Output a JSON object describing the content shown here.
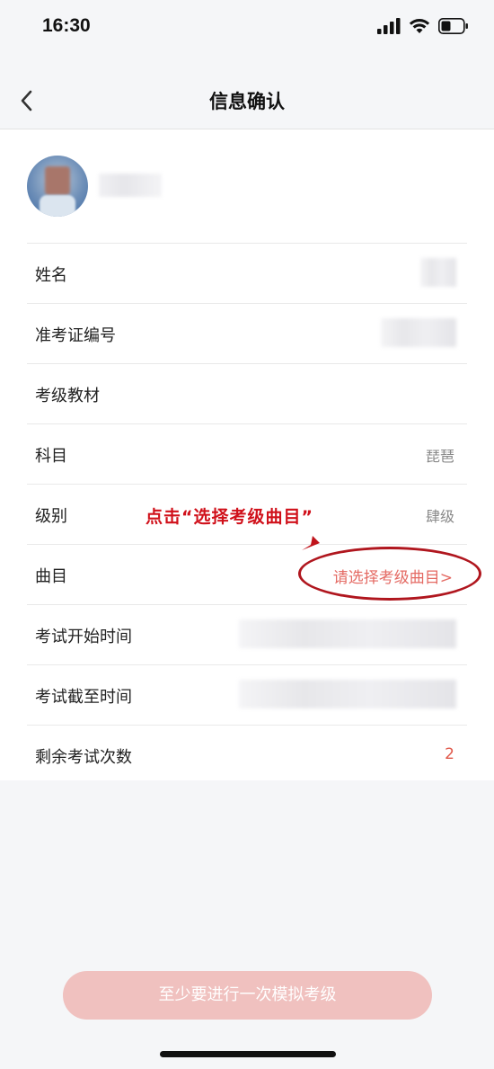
{
  "status_bar": {
    "time": "16:30"
  },
  "header": {
    "title": "信息确认"
  },
  "form": {
    "name_label": "姓名",
    "ticket_label": "准考证编号",
    "textbook_label": "考级教材",
    "subject_label": "科目",
    "subject_value": "琵琶",
    "level_label": "级别",
    "level_value": "肆级",
    "piece_label": "曲目",
    "piece_select": "请选择考级曲目>",
    "start_time_label": "考试开始时间",
    "end_time_label": "考试截至时间",
    "remaining_label": "剩余考试次数",
    "remaining_value": "2"
  },
  "annotation": {
    "text": "点击“选择考级曲目”"
  },
  "footer": {
    "button_label": "至少要进行一次模拟考级"
  },
  "colors": {
    "accent": "#e46a63",
    "button_bg": "#f0c1bf",
    "annotation": "#d0101a"
  },
  "icons": [
    "back-icon",
    "signal-icon",
    "wifi-icon",
    "battery-icon"
  ]
}
